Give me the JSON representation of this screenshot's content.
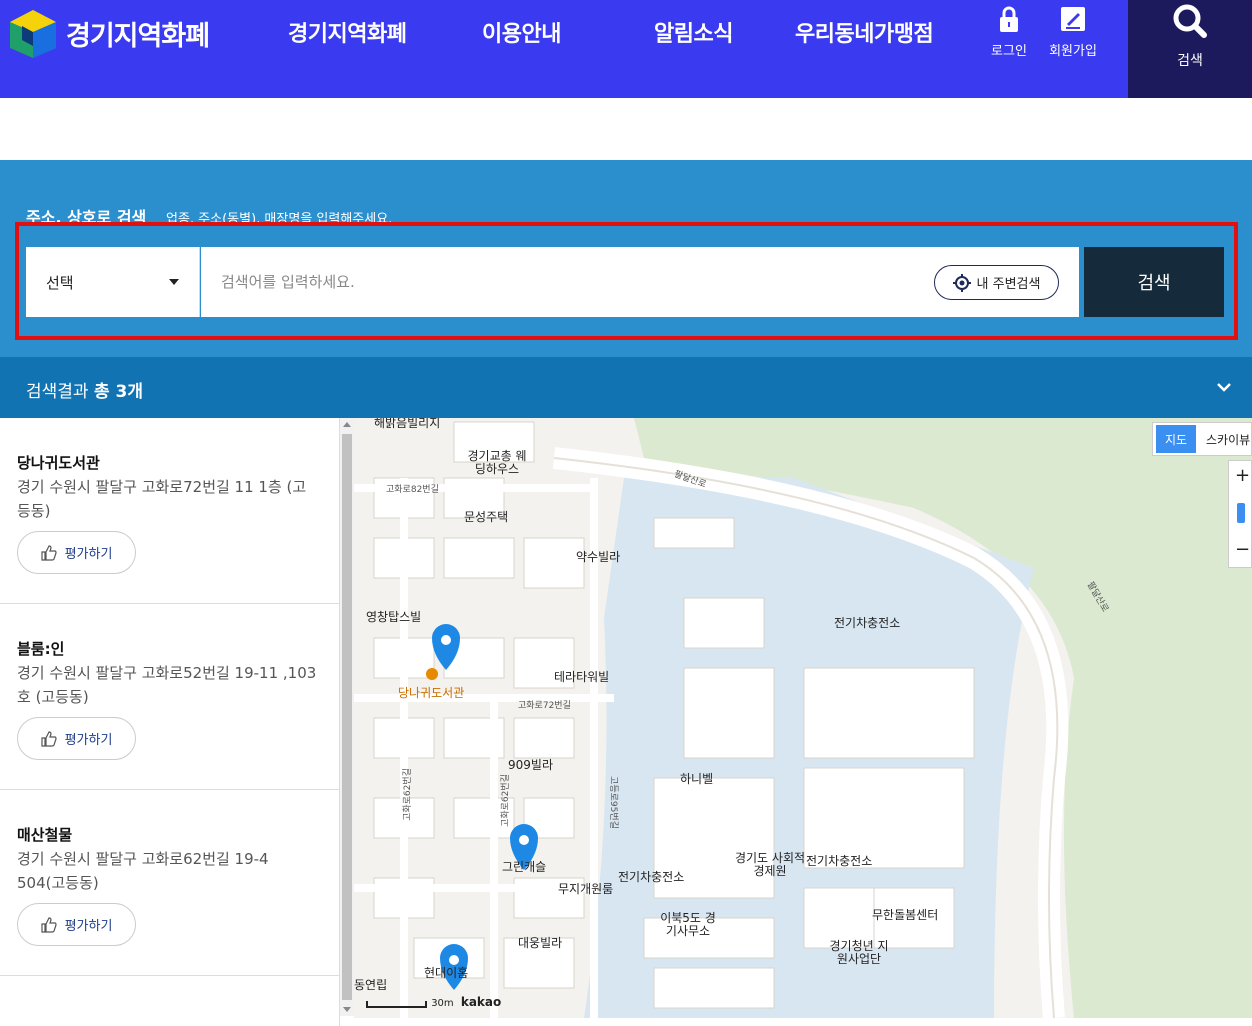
{
  "header": {
    "logo_text": "경기지역화폐",
    "nav": [
      "경기지역화폐",
      "이용안내",
      "알림소식",
      "우리동네가맹점"
    ],
    "login_label": "로그인",
    "signup_label": "회원가입",
    "search_label": "검색"
  },
  "search_panel": {
    "title": "주소, 상호로 검색",
    "hint": "업종, 주소(동별), 매장명을 입력해주세요.",
    "select_value": "선택",
    "input_placeholder": "검색어를 입력하세요.",
    "near_label": "내 주변검색",
    "search_button": "검색"
  },
  "result_bar": {
    "prefix": "검색결과",
    "count": "총 3개"
  },
  "results": [
    {
      "name": "당나귀도서관",
      "address": "경기 수원시 팔달구 고화로72번길 11 1층 (고등동)",
      "rate_label": "평가하기"
    },
    {
      "name": "블룸:인",
      "address": "경기 수원시 팔달구 고화로52번길 19-11 ,103호 (고등동)",
      "rate_label": "평가하기"
    },
    {
      "name": "매산철물",
      "address": "경기 수원시 팔달구 고화로62번길 19-4 504(고등동)",
      "rate_label": "평가하기"
    }
  ],
  "map": {
    "type_selected": "지도",
    "type_other": "스카이뷰",
    "zoom_in": "+",
    "zoom_out": "−",
    "scale_label": "30m",
    "brand": "kakao",
    "labels": [
      "해밝음빌리지",
      "경기교총 웨딩하우스",
      "고화로82번길",
      "문성주택",
      "약수빌라",
      "팔달산로",
      "영창탑스빌",
      "전기차충전소",
      "당나귀도서관",
      "테라타워빌",
      "고화로72번길",
      "909빌라",
      "하니벨",
      "고화로62번길",
      "고화로62번길",
      "고등로95번길",
      "그린캐슬",
      "무지개원룸",
      "전기차충전소",
      "경기도 사회적경제원",
      "전기차충전소",
      "이북5도 경기사무소",
      "무한돌봄센터",
      "경기청년 지원사업단",
      "대웅빌라",
      "현대이홈",
      "동연립",
      "팔달산로"
    ]
  },
  "colors": {
    "header_bg": "#3a3af0",
    "header_search_bg": "#1c1a5c",
    "panel_bg": "#2b8fce",
    "result_bar_bg": "#1173b2",
    "search_btn_bg": "#152a3a",
    "highlight_border": "#e01010",
    "marker": "#1e88e5"
  },
  "icons": [
    "logo-mark-icon",
    "lock-icon",
    "pen-icon",
    "search-icon",
    "location-target-icon",
    "chevron-down-icon",
    "thumbs-up-icon",
    "map-marker-icon"
  ]
}
